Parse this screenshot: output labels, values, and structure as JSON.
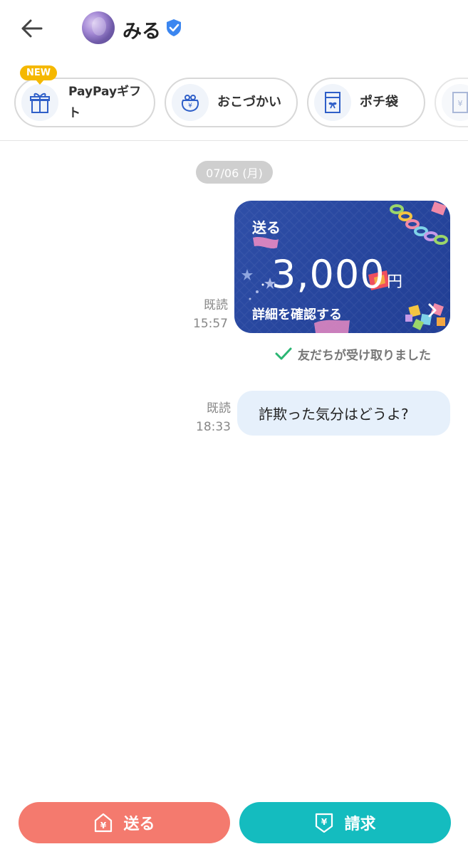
{
  "header": {
    "contact_name": "みる",
    "icons": {
      "back": "arrow-left-icon",
      "verified": "verified-check-icon"
    },
    "verified_color": "#3b86f0"
  },
  "gift_row": {
    "new_badge": "NEW",
    "items": [
      {
        "label": "PayPayギフト",
        "label_line1": "PayPayギフ",
        "label_line2": "ト",
        "icon": "gift-box-icon"
      },
      {
        "label": "おこづかい",
        "icon": "coin-purse-icon"
      },
      {
        "label": "ポチ袋",
        "icon": "envelope-bow-icon"
      },
      {
        "label": "",
        "icon": "yen-card-icon"
      }
    ]
  },
  "chat": {
    "date": "07/06 (月)",
    "messages": [
      {
        "type": "money-card",
        "card_title": "送る",
        "amount": "3,000",
        "currency": "円",
        "detail_link": "詳細を確認する",
        "read_label": "既読",
        "time": "15:57",
        "status": "友だちが受け取りました",
        "card_color": "#27469e"
      },
      {
        "type": "text",
        "text": "詐欺った気分はどうよ?",
        "read_label": "既読",
        "time": "18:33",
        "bubble_color": "#e6f0fb"
      }
    ]
  },
  "bottom": {
    "send_label": "送る",
    "request_label": "請求",
    "send_color": "#f47a6e",
    "request_color": "#14bcbf",
    "send_icon": "yen-house-icon",
    "request_icon": "yen-shield-icon"
  }
}
